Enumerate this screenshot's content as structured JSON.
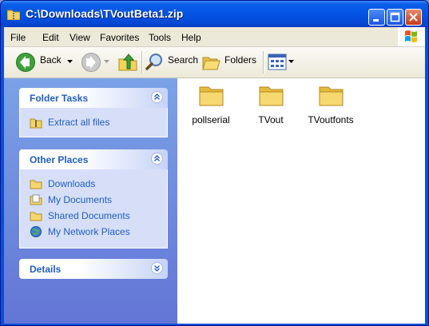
{
  "window": {
    "title": "C:\\Downloads\\TVoutBeta1.zip"
  },
  "menu": {
    "items": [
      "File",
      "Edit",
      "View",
      "Favorites",
      "Tools",
      "Help"
    ]
  },
  "toolbar": {
    "back_label": "Back",
    "search_label": "Search",
    "folders_label": "Folders"
  },
  "folder_tasks": {
    "title": "Folder Tasks",
    "items": [
      {
        "label": "Extract all files",
        "icon": "zip-extract-icon"
      }
    ]
  },
  "other_places": {
    "title": "Other Places",
    "items": [
      {
        "label": "Downloads",
        "icon": "folder-icon"
      },
      {
        "label": "My Documents",
        "icon": "documents-folder-icon"
      },
      {
        "label": "Shared Documents",
        "icon": "folder-icon"
      },
      {
        "label": "My Network Places",
        "icon": "network-places-icon"
      }
    ]
  },
  "details": {
    "title": "Details"
  },
  "files": [
    {
      "name": "pollserial",
      "icon": "folder-icon"
    },
    {
      "name": "TVout",
      "icon": "folder-icon"
    },
    {
      "name": "TVoutfonts",
      "icon": "folder-icon"
    }
  ],
  "colors": {
    "title_bar": "#0453e3",
    "task_pane": "#6f8fdf",
    "link": "#215dc6",
    "folder": "#f5d66e"
  }
}
